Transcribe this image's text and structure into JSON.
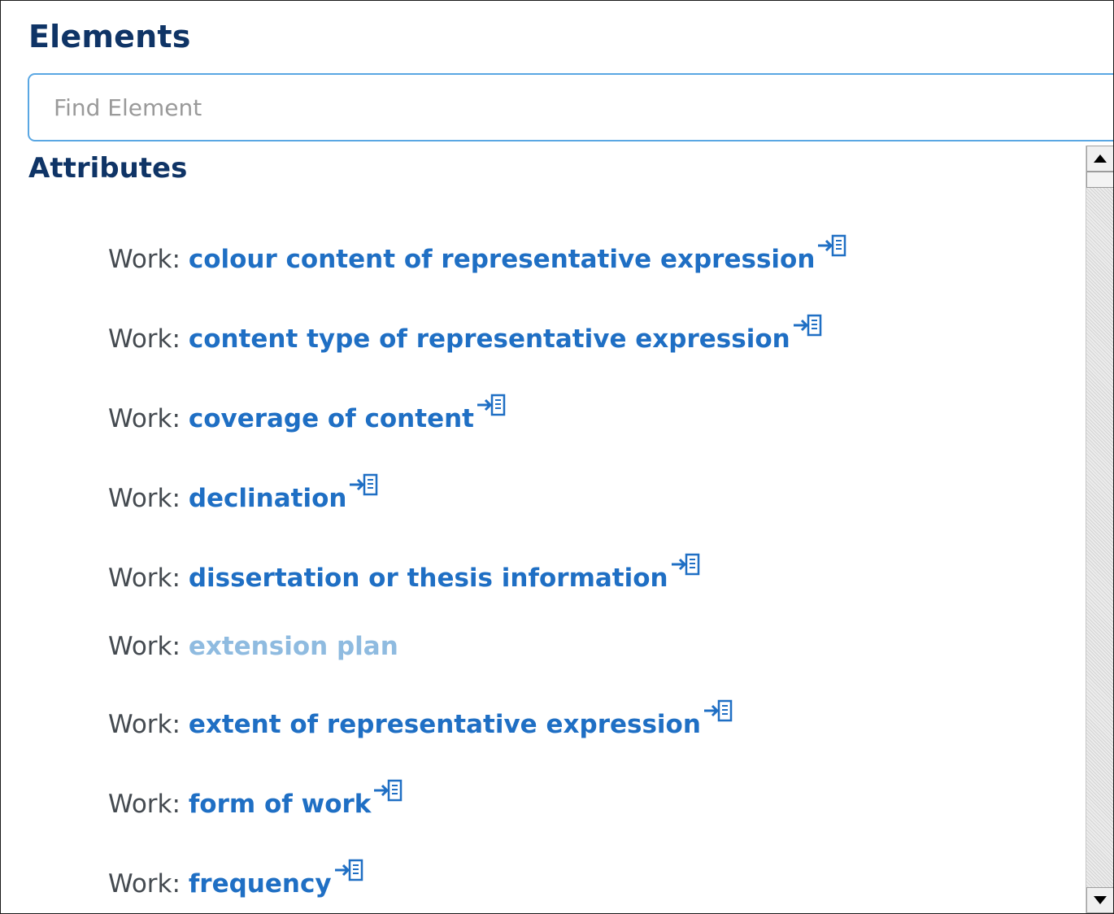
{
  "panel": {
    "title": "Elements",
    "search": {
      "placeholder": "Find Element",
      "value": ""
    }
  },
  "attributes": {
    "heading": "Attributes",
    "items": [
      {
        "prefix": "Work:",
        "label": "colour content of representative expression",
        "has_icon": true
      },
      {
        "prefix": "Work:",
        "label": "content type of representative expression",
        "has_icon": true
      },
      {
        "prefix": "Work:",
        "label": "coverage of content",
        "has_icon": true
      },
      {
        "prefix": "Work:",
        "label": "declination",
        "has_icon": true
      },
      {
        "prefix": "Work:",
        "label": "dissertation or thesis information",
        "has_icon": true
      },
      {
        "prefix": "Work:",
        "label": "extension plan",
        "has_icon": false
      },
      {
        "prefix": "Work:",
        "label": "extent of representative expression",
        "has_icon": true
      },
      {
        "prefix": "Work:",
        "label": "form of work",
        "has_icon": true
      },
      {
        "prefix": "Work:",
        "label": "frequency",
        "has_icon": true
      }
    ]
  },
  "icons": {
    "insert": "insert-element-icon",
    "scroll_up": "scroll-up-arrow-icon",
    "scroll_down": "scroll-down-arrow-icon"
  },
  "colors": {
    "heading": "#0f3466",
    "link": "#1f6fc4",
    "link_inactive": "#8fbbe0",
    "prefix": "#444a50",
    "input_border": "#5aa7e3"
  }
}
